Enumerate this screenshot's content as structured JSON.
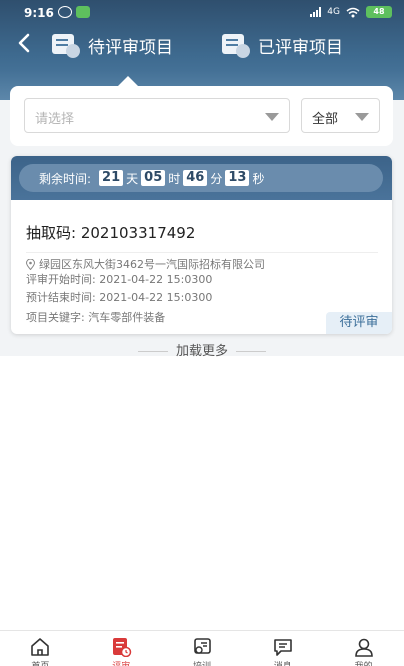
{
  "status_bar": {
    "time": "9:16",
    "signal": "4G",
    "battery": "48"
  },
  "header": {
    "tabs": [
      {
        "label": "待评审项目",
        "active": true
      },
      {
        "label": "已评审项目",
        "active": false
      }
    ]
  },
  "filter": {
    "select_placeholder": "请选择",
    "scope_value": "全部"
  },
  "card": {
    "countdown_label": "剩余时间:",
    "countdown": {
      "days": "21",
      "days_unit": "天",
      "hours": "05",
      "hours_unit": "时",
      "minutes": "46",
      "minutes_unit": "分",
      "seconds": "13",
      "seconds_unit": "秒"
    },
    "code_label": "抽取码:",
    "code_value": "202103317492",
    "address": "绿园区东风大街3462号一汽国际招标有限公司",
    "start_time": "评审开始时间:  2021-04-22 15:0300",
    "end_time": "预计结束时间:  2021-04-22 15:0300",
    "keywords": "项目关键字: 汽车零部件装备",
    "status": "待评审"
  },
  "load_more": "加载更多",
  "bottom_nav": {
    "items": [
      {
        "label": "首页",
        "icon": "home-icon"
      },
      {
        "label": "评审",
        "icon": "review-icon",
        "active": true
      },
      {
        "label": "培训",
        "icon": "training-icon"
      },
      {
        "label": "消息",
        "icon": "message-icon"
      },
      {
        "label": "我的",
        "icon": "profile-icon"
      }
    ]
  },
  "colors": {
    "header": "#3e6a8f",
    "accent": "#d93a3a",
    "badge_text": "#3c6f9a"
  }
}
